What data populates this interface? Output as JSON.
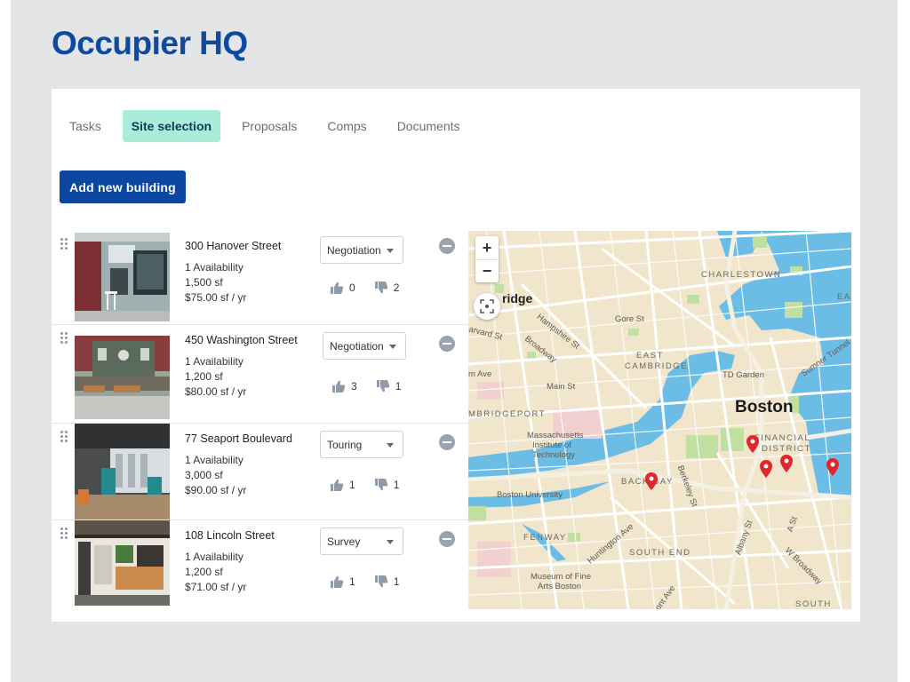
{
  "app": {
    "title": "Occupier HQ"
  },
  "tabs": [
    {
      "label": "Tasks",
      "active": false
    },
    {
      "label": "Site selection",
      "active": true
    },
    {
      "label": "Proposals",
      "active": false
    },
    {
      "label": "Comps",
      "active": false
    },
    {
      "label": "Documents",
      "active": false
    }
  ],
  "actions": {
    "add_building_label": "Add new building"
  },
  "buildings": [
    {
      "address": "300 Hanover Street",
      "availability": "1 Availability",
      "size": "1,500 sf",
      "rate": "$75.00 sf / yr",
      "status": "Negotiation",
      "thumbs_up": "0",
      "thumbs_down": "2"
    },
    {
      "address": "450 Washington Street",
      "availability": "1 Availability",
      "size": "1,200 sf",
      "rate": "$80.00 sf / yr",
      "status": "Negotiation",
      "thumbs_up": "3",
      "thumbs_down": "1"
    },
    {
      "address": "77 Seaport Boulevard",
      "availability": "1 Availability",
      "size": "3,000 sf",
      "rate": "$90.00 sf / yr",
      "status": "Touring",
      "thumbs_up": "1",
      "thumbs_down": "1"
    },
    {
      "address": "108 Lincoln Street",
      "availability": "1 Availability",
      "size": "1,200 sf",
      "rate": "$71.00 sf / yr",
      "status": "Survey",
      "thumbs_up": "1",
      "thumbs_down": "1"
    }
  ],
  "map": {
    "zoom_in": "+",
    "zoom_out": "−",
    "labels": {
      "charlestown": "CHARLESTOWN",
      "cambridge": "ridge",
      "east_cambridge_1": "EAST",
      "east_cambridge_2": "CAMBRIDGE",
      "boston": "Boston",
      "financial_1": "FINANCIAL",
      "financial_2": "DISTRICT",
      "cambridgeport": "MBRIDGEPORT",
      "fenway": "FENWAY",
      "south_end": "SOUTH END",
      "back_bay": "BACK BAY",
      "south": "SOUTH",
      "ea": "EA",
      "gore_st": "Gore St",
      "hampshire_st": "Hampshire St",
      "broadway": "Broadway",
      "harvard_st": "arvard St",
      "main_st": "Main St",
      "m_ave": "m Ave",
      "td_garden": "TD Garden",
      "sumner_tunnel": "Sumner Tunnel",
      "mit_1": "Massachusetts",
      "mit_2": "Institute of",
      "mit_3": "Technology",
      "boston_university": "Boston University",
      "berkeley_st": "Berkeley St",
      "huntington_ave": "Huntington Ave",
      "museum_1": "Museum of Fine",
      "museum_2": "Arts Boston",
      "albany_st": "Albany St",
      "w_broadway": "W Broadway",
      "tremont": "ont Ave",
      "a_st": "A St"
    }
  },
  "colors": {
    "brand": "#0d4aa0",
    "button": "#0b47a0",
    "active_tab": "#a9ecd9",
    "water": "#6bbde6",
    "land": "#f1e5cc",
    "park": "#bfe0a0",
    "pin": "#e0262b"
  }
}
